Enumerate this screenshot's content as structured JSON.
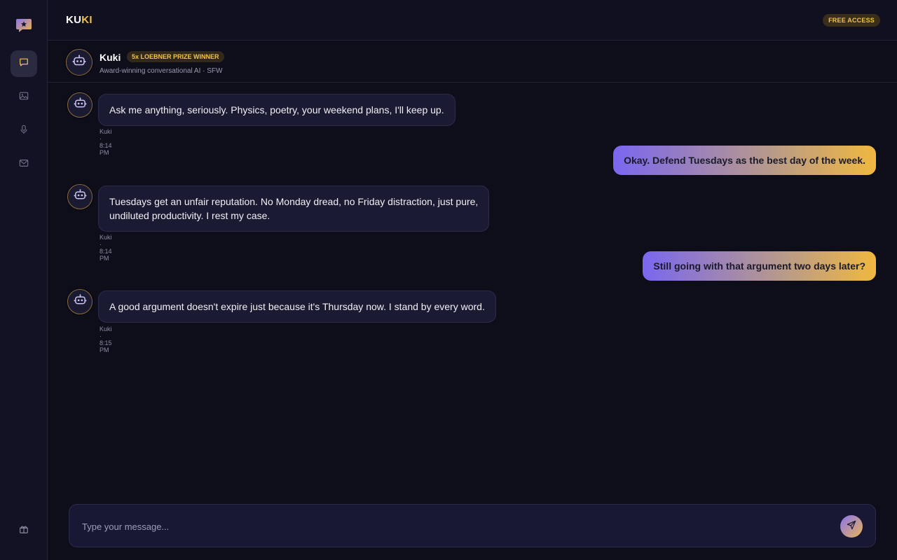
{
  "brand": {
    "part1": "KU",
    "part2": "KI"
  },
  "topbar": {
    "badge": "FREE ACCESS"
  },
  "sidebar": {
    "items": [
      {
        "icon": "chat-icon",
        "active": true
      },
      {
        "icon": "image-icon",
        "active": false
      },
      {
        "icon": "microphone-icon",
        "active": false
      },
      {
        "icon": "mail-icon",
        "active": false
      }
    ],
    "bottom_icon": "gift-icon"
  },
  "bot": {
    "name": "Kuki",
    "badge": "5x LOEBNER PRIZE WINNER",
    "subtitle": "Award-winning conversational AI · SFW"
  },
  "messages": [
    {
      "from": "bot",
      "text": "Ask me anything, seriously. Physics, poetry, your weekend plans, I'll keep up.",
      "meta": "Kuki · 8:14 PM"
    },
    {
      "from": "user",
      "text": "Okay. Defend Tuesdays as the best day of the week."
    },
    {
      "from": "bot",
      "line1": "Tuesdays get an unfair reputation. No Monday dread, no Friday distraction, just pure,",
      "line2": "undiluted productivity. I rest my case.",
      "meta": "Kuki · 8:14 PM"
    },
    {
      "from": "user",
      "text": "Still going with that argument two days later?"
    },
    {
      "from": "bot",
      "text": "A good argument doesn't expire just because it's Thursday now. I stand by every word.",
      "meta": "Kuki · 8:15 PM"
    }
  ],
  "composer": {
    "placeholder": "Type your message...",
    "send_icon": "send-icon"
  },
  "colors": {
    "background": "#0e0e1b",
    "accent_gold": "#f1c24a",
    "accent_purple": "#7a67f0",
    "bot_bubble": "#1a1a32"
  }
}
